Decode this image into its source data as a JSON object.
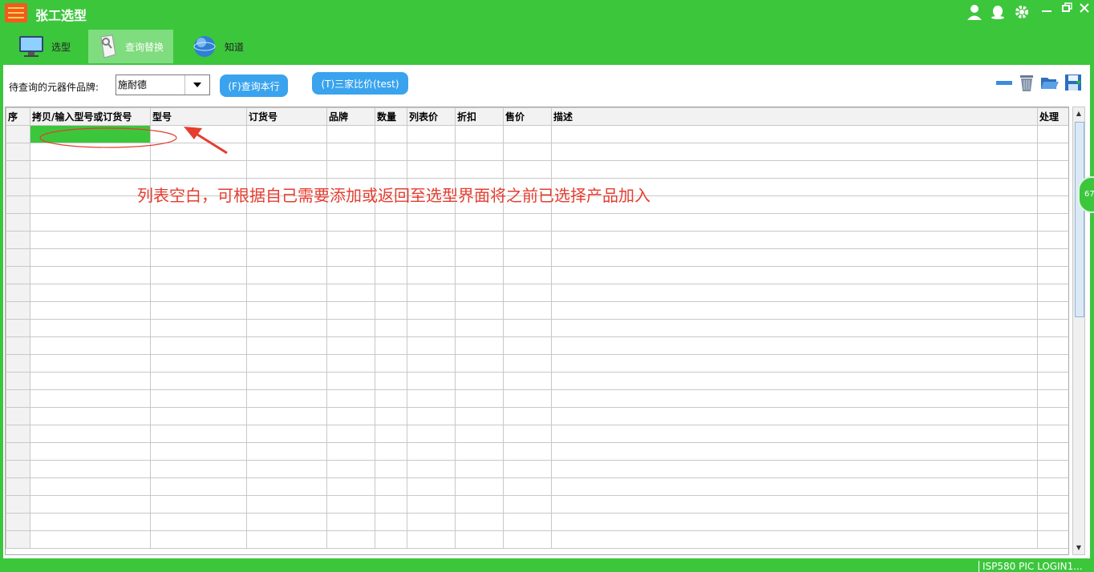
{
  "app": {
    "title": "张工选型"
  },
  "titlebar_icons": [
    "user-icon",
    "qq-icon",
    "settings-icon",
    "minimize-icon",
    "restore-icon",
    "close-icon"
  ],
  "tabs": [
    {
      "label": "选型",
      "icon": "monitor-icon",
      "active": false
    },
    {
      "label": "查询替换",
      "icon": "document-search-icon",
      "active": true
    },
    {
      "label": "知道",
      "icon": "globe-icon",
      "active": false
    }
  ],
  "toolbar": {
    "brand_label": "待查询的元器件品牌:",
    "brand_value": "施耐德",
    "query_row_button": "(F)查询本行",
    "compare_button": "(T)三家比价(test)",
    "right_icons": [
      "remove-row-icon",
      "delete-icon",
      "open-folder-icon",
      "save-icon"
    ]
  },
  "table": {
    "columns": [
      "序",
      "拷贝/输入型号或订货号",
      "型号",
      "订货号",
      "品牌",
      "数量",
      "列表价",
      "折扣",
      "售价",
      "描述",
      "处理"
    ],
    "row_count": 24
  },
  "annotation": {
    "text": "列表空白，可根据自己需要添加或返回至选型界面将之前已选择产品加入"
  },
  "side_badge": "67",
  "status": {
    "text": "ISP580 PIC LOGIN1..."
  },
  "colors": {
    "brand_green": "#3cc63c",
    "button_blue": "#3aa3ee",
    "annotation_red": "#e53d2f",
    "selected_cell": "#3cc63c"
  }
}
